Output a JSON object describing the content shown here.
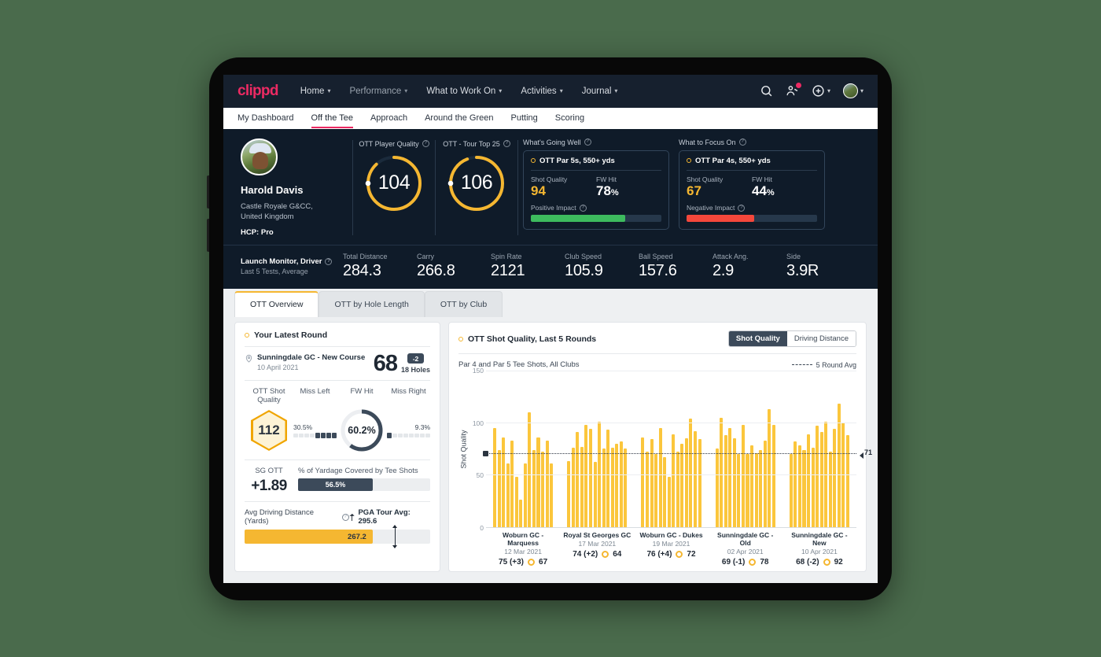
{
  "brand": {
    "logo": "clippd",
    "accent": "#ec2a63",
    "amber": "#f5b731",
    "dark": "#0f1b29"
  },
  "topnav": {
    "items": [
      {
        "label": "Home",
        "caret": "⌄"
      },
      {
        "label": "Performance",
        "caret": "⌄"
      },
      {
        "label": "What to Work On",
        "caret": "⌄"
      },
      {
        "label": "Activities",
        "caret": "⌄"
      },
      {
        "label": "Journal",
        "caret": "⌄"
      }
    ],
    "icons": [
      "search-icon",
      "people-add-icon",
      "plus-circle-icon",
      "avatar"
    ]
  },
  "subnav": {
    "tabs": [
      {
        "label": "My Dashboard",
        "active": false
      },
      {
        "label": "Off the Tee",
        "active": true
      },
      {
        "label": "Approach",
        "active": false
      },
      {
        "label": "Around the Green",
        "active": false
      },
      {
        "label": "Putting",
        "active": false
      },
      {
        "label": "Scoring",
        "active": false
      }
    ]
  },
  "profile": {
    "name": "Harold Davis",
    "club": "Castle Royale G&CC,",
    "country": "United Kingdom",
    "hcp": "HCP: Pro"
  },
  "gauges": [
    {
      "label": "OTT Player Quality",
      "value": "104",
      "pct": 0.88
    },
    {
      "label": "OTT - Tour Top 25",
      "value": "106",
      "pct": 0.94
    }
  ],
  "going_well": {
    "label": "What's Going Well",
    "title": "OTT Par 5s, 550+ yds",
    "shot_quality_label": "Shot Quality",
    "shot_quality": "94",
    "fw_hit_label": "FW Hit",
    "fw_hit": "78",
    "fw_hit_unit": "%",
    "impact_label": "Positive Impact",
    "impact_pct": 72,
    "impact_color": "#3dbb5e"
  },
  "focus_on": {
    "label": "What to Focus On",
    "title": "OTT Par 4s, 550+ yds",
    "shot_quality_label": "Shot Quality",
    "shot_quality": "67",
    "fw_hit_label": "FW Hit",
    "fw_hit": "44",
    "fw_hit_unit": "%",
    "impact_label": "Negative Impact",
    "impact_pct": 52,
    "impact_color": "#f4473b"
  },
  "launch_monitor": {
    "title": "Launch Monitor, Driver",
    "subtitle": "Last 5 Tests, Average",
    "stats": [
      {
        "key": "Total Distance",
        "value": "284.3"
      },
      {
        "key": "Carry",
        "value": "266.8"
      },
      {
        "key": "Spin Rate",
        "value": "2121"
      },
      {
        "key": "Club Speed",
        "value": "105.9"
      },
      {
        "key": "Ball Speed",
        "value": "157.6"
      },
      {
        "key": "Attack Ang.",
        "value": "2.9"
      },
      {
        "key": "Side",
        "value": "3.9R"
      }
    ]
  },
  "view_tabs": [
    {
      "label": "OTT Overview",
      "active": true
    },
    {
      "label": "OTT by Hole Length",
      "active": false
    },
    {
      "label": "OTT by Club",
      "active": false
    }
  ],
  "latest_round": {
    "title": "Your Latest Round",
    "course": "Sunningdale GC - New Course",
    "date": "10 April 2021",
    "score": "68",
    "to_par": "-2",
    "holes": "18 Holes",
    "shot_quality_label": "OTT Shot Quality",
    "shot_quality": "112",
    "miss_left_label": "Miss Left",
    "miss_left": "30.5%",
    "miss_left_segments_on": 4,
    "fw_hit_label": "FW Hit",
    "fw_hit": "60.2%",
    "fw_hit_pct": 60.2,
    "miss_right_label": "Miss Right",
    "miss_right": "9.3%",
    "miss_right_segments_on": 1,
    "sg_label": "SG OTT",
    "sg_value": "+1.89",
    "yardage_label": "% of Yardage Covered by Tee Shots",
    "yardage_value": "56.5%",
    "yardage_pct": 56.5,
    "avg_drive_label": "Avg Driving Distance (Yards)",
    "tour_avg_label": "PGA Tour Avg: 295.6",
    "avg_drive_value": "267.2",
    "avg_drive_pct": 69,
    "tour_marker_pct": 81
  },
  "chart_card": {
    "title": "OTT Shot Quality, Last 5 Rounds",
    "toggle": [
      {
        "label": "Shot Quality",
        "active": true
      },
      {
        "label": "Driving Distance",
        "active": false
      }
    ],
    "subtitle": "Par 4 and Par 5 Tee Shots, All Clubs",
    "legend": "5 Round Avg"
  },
  "chart_data": {
    "type": "bar",
    "title": "OTT Shot Quality, Last 5 Rounds",
    "subtitle": "Par 4 and Par 5 Tee Shots, All Clubs",
    "ylabel": "Shot Quality",
    "xlabel": "",
    "ylim": [
      0,
      150
    ],
    "yticks": [
      0,
      50,
      100,
      150
    ],
    "grid": true,
    "average_line": 71,
    "average_label": "71",
    "legend": "5 Round Avg",
    "legend_position": "top-right",
    "bar_color": "#fbc63c",
    "groups": [
      {
        "name": "Woburn GC - Marquess",
        "date": "12 Mar 2021",
        "score": "75 (+3)",
        "quality": "67",
        "values": [
          95,
          74,
          86,
          61,
          83,
          48,
          26,
          61,
          110,
          74,
          86,
          72,
          83,
          61
        ]
      },
      {
        "name": "Royal St Georges GC",
        "date": "17 Mar 2021",
        "score": "74 (+2)",
        "quality": "64",
        "values": [
          63,
          76,
          91,
          77,
          98,
          94,
          62,
          101,
          75,
          93,
          76,
          80,
          82,
          75
        ]
      },
      {
        "name": "Woburn GC - Dukes",
        "date": "19 Mar 2021",
        "score": "76 (+4)",
        "quality": "72",
        "values": [
          86,
          72,
          84,
          70,
          95,
          67,
          48,
          89,
          72,
          80,
          85,
          104,
          92,
          84
        ]
      },
      {
        "name": "Sunningdale GC - Old",
        "date": "02 Apr 2021",
        "score": "69 (-1)",
        "quality": "78",
        "values": [
          75,
          105,
          88,
          95,
          85,
          70,
          98,
          70,
          78,
          71,
          74,
          83,
          113,
          98
        ]
      },
      {
        "name": "Sunningdale GC - New",
        "date": "10 Apr 2021",
        "score": "68 (-2)",
        "quality": "92",
        "values": [
          70,
          82,
          78,
          74,
          89,
          76,
          97,
          91,
          101,
          72,
          94,
          118,
          100,
          88
        ]
      }
    ]
  }
}
